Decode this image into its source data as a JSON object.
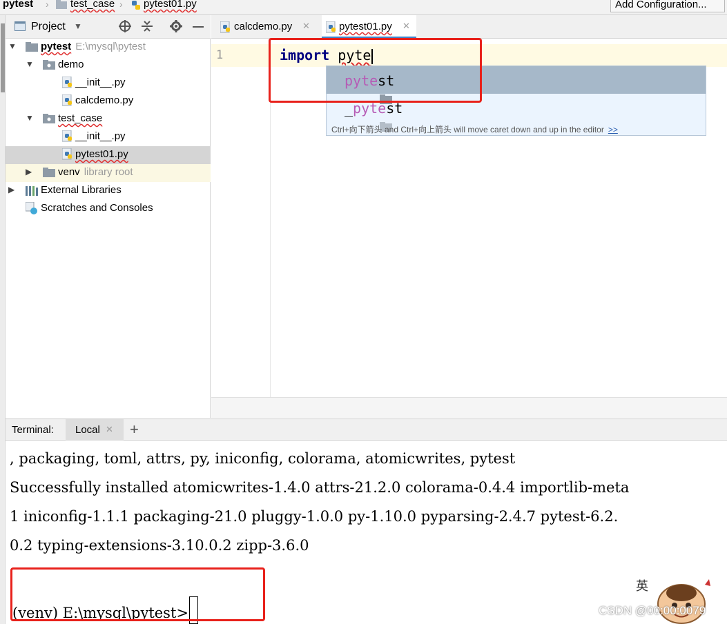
{
  "breadcrumb": {
    "items": [
      "pytest",
      "test_case",
      "pytest01.py"
    ]
  },
  "toolbar": {
    "add_configuration": "Add Configuration..."
  },
  "project_panel": {
    "title": "Project",
    "tree": [
      {
        "label": "pytest",
        "hint": "E:\\mysql\\pytest"
      },
      {
        "label": "demo"
      },
      {
        "label": "__init__.py"
      },
      {
        "label": "calcdemo.py"
      },
      {
        "label": "test_case"
      },
      {
        "label": "__init__.py"
      },
      {
        "label": "pytest01.py"
      },
      {
        "label": "venv",
        "hint": "library root"
      },
      {
        "label": "External Libraries"
      },
      {
        "label": "Scratches and Consoles"
      }
    ]
  },
  "editor": {
    "tabs": [
      {
        "label": "calcdemo.py"
      },
      {
        "label": "pytest01.py"
      }
    ],
    "line_number": "1",
    "code": {
      "keyword": "import",
      "typed": "pyte"
    },
    "completion": {
      "items": [
        {
          "match": "pyte",
          "rest": "st"
        },
        {
          "prefix": "_",
          "match": "pyte",
          "rest": "st"
        }
      ],
      "hint": "Ctrl+向下箭头 and Ctrl+向上箭头 will move caret down and up in the editor",
      "hint_link": ">>"
    }
  },
  "terminal": {
    "title": "Terminal:",
    "tab": "Local",
    "add": "+",
    "lines": [
      ", packaging, toml, attrs, py, iniconfig, colorama, atomicwrites, pytest",
      "Successfully installed atomicwrites-1.4.0 attrs-21.2.0 colorama-0.4.4 importlib-meta",
      "1 iniconfig-1.1.1 packaging-21.0 pluggy-1.0.0 py-1.10.0 pyparsing-2.4.7 pytest-6.2.",
      "0.2 typing-extensions-3.10.0.2 zipp-3.6.0"
    ],
    "prompt": "(venv) E:\\mysql\\pytest>"
  },
  "watermark": "CSDN @00:00:0079",
  "colors": {
    "annotation_red": "#e8211b",
    "selection_blue": "#a6b8c9",
    "keyword_navy": "#000080",
    "match_magenta": "#b65bb5"
  }
}
